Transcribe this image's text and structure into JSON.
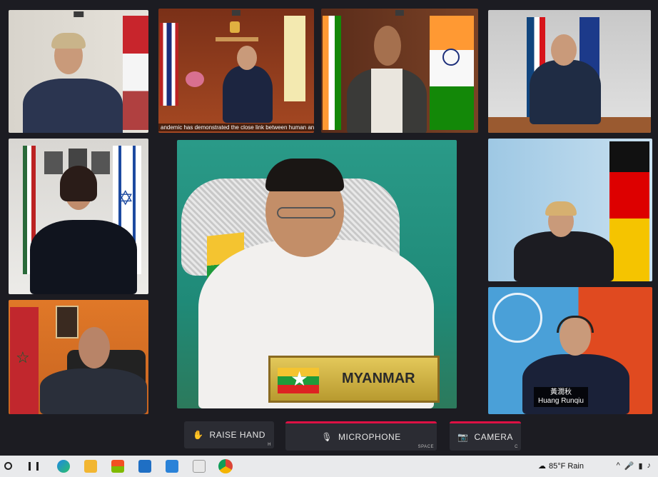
{
  "participants": [
    {
      "id": "netherlands"
    },
    {
      "id": "thailand",
      "caption": "andemic has demonstrated the close link between human and n"
    },
    {
      "id": "india"
    },
    {
      "id": "czech"
    },
    {
      "id": "israel"
    },
    {
      "id": "myanmar",
      "nameplate": "MYANMAR"
    },
    {
      "id": "germany"
    },
    {
      "id": "morocco"
    },
    {
      "id": "un",
      "name_cn": "黃潤秋",
      "name_en": "Huang Runqiu"
    }
  ],
  "controls": {
    "raise_hand": {
      "label": "RAISE HAND",
      "hint": "H"
    },
    "microphone": {
      "label": "MICROPHONE",
      "hint": "SPACE"
    },
    "camera": {
      "label": "CAMERA",
      "hint": "C"
    }
  },
  "taskbar": {
    "weather": "85°F  Rain",
    "icons": [
      "search-icon",
      "task-view-icon",
      "edge-icon",
      "file-explorer-icon",
      "store-icon",
      "mail-icon",
      "photos-icon",
      "chart-app-icon",
      "chrome-icon"
    ]
  },
  "colors": {
    "accent_red": "#dd1144",
    "background": "#1c1c22",
    "button": "#2b2c33"
  }
}
